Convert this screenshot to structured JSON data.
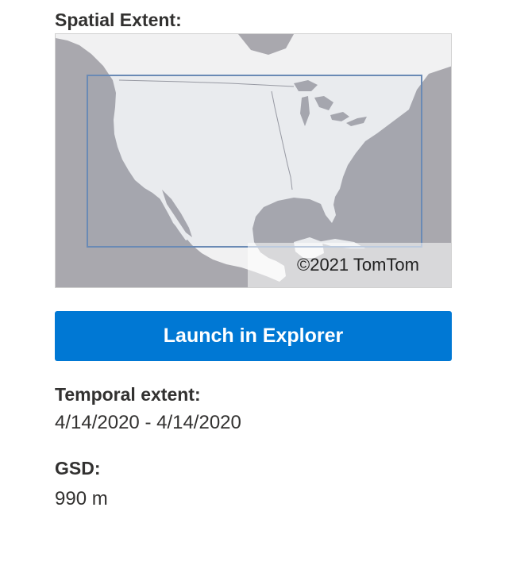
{
  "spatial": {
    "heading": "Spatial Extent:",
    "map_attribution": "©2021 TomTom",
    "colors": {
      "water": "#a9a8ae",
      "land": "#f1f1f2",
      "boundary": "#6a8ab5"
    }
  },
  "actions": {
    "launch_label": "Launch in Explorer",
    "accent_color": "#0078d4"
  },
  "temporal": {
    "heading": "Temporal extent:",
    "value": "4/14/2020 - 4/14/2020"
  },
  "gsd": {
    "heading": "GSD:",
    "value": "990 m"
  }
}
